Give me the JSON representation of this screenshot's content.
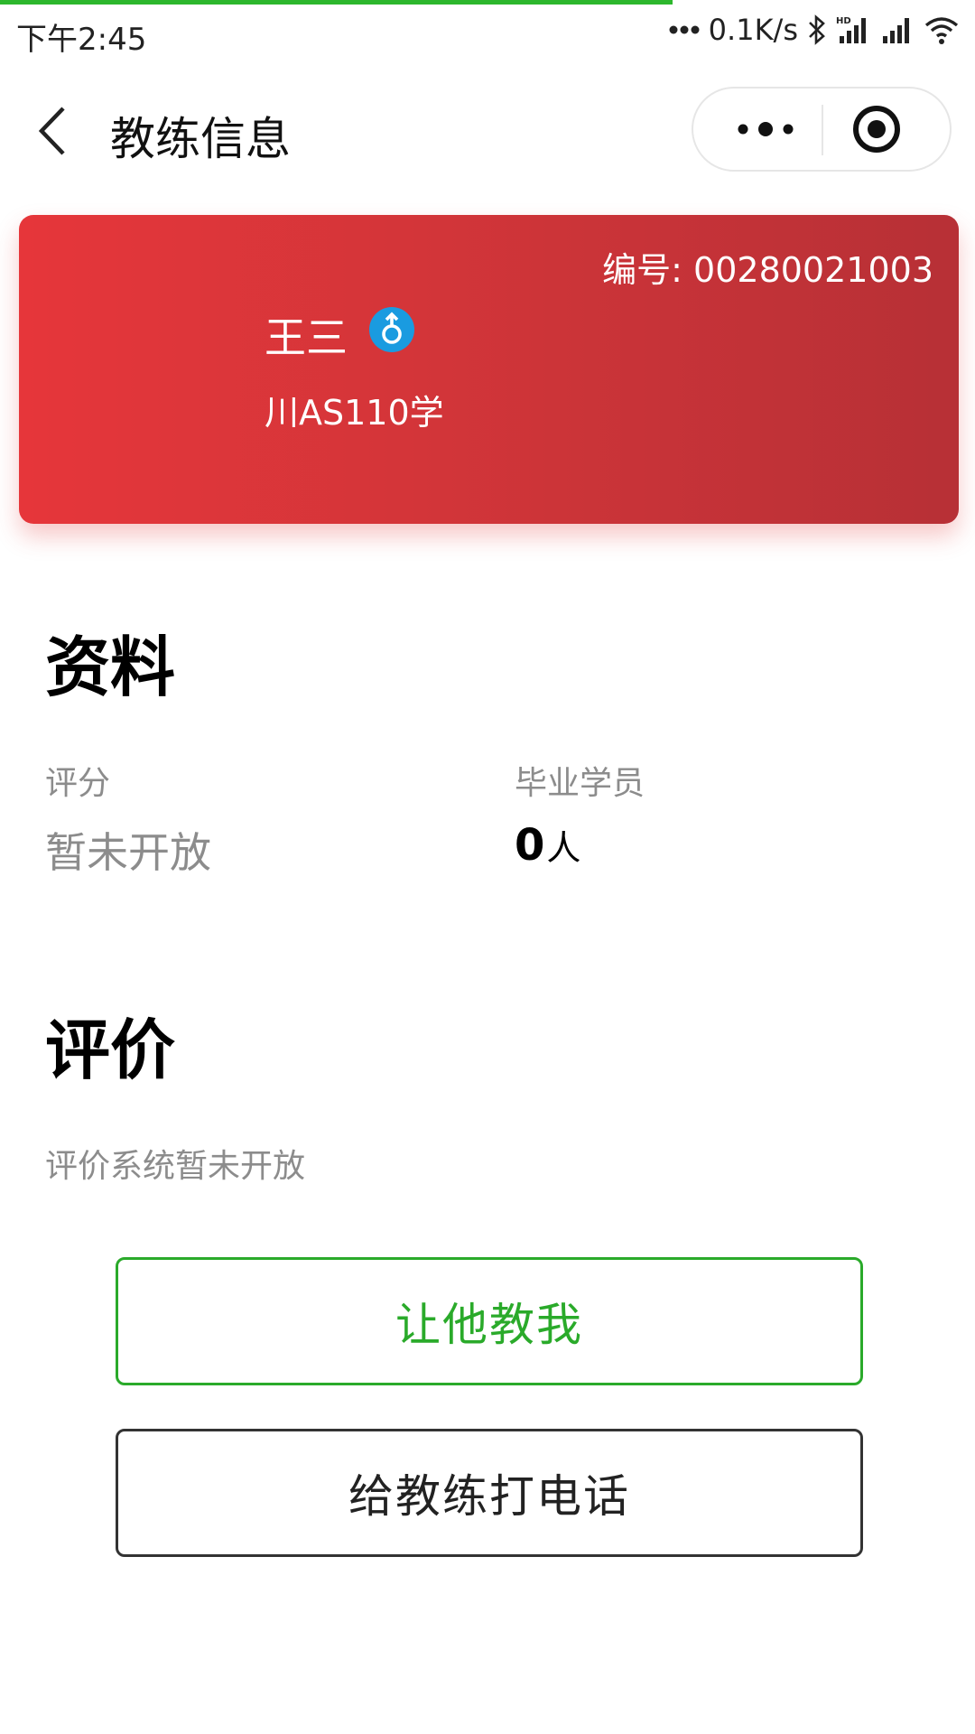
{
  "status_bar": {
    "time": "下午2:45",
    "net_speed": "0.1K/s",
    "hd_label": "HD"
  },
  "loading_progress": 0.69,
  "nav": {
    "title": "教练信息"
  },
  "coach_card": {
    "id_label": "编号",
    "id_value": "00280021003",
    "name": "王三",
    "gender": "male",
    "plate": "川AS110学",
    "colors": {
      "gradient_start": "#e6363a",
      "gradient_end": "#b73036",
      "gender_icon": "#1a9be0"
    }
  },
  "profile": {
    "title": "资料",
    "rating_label": "评分",
    "rating_value": "暂未开放",
    "graduates_label": "毕业学员",
    "graduates_value": "0",
    "graduates_unit": "人"
  },
  "reviews": {
    "title": "评价",
    "empty_text": "评价系统暂未开放"
  },
  "buttons": {
    "teach_me": "让他教我",
    "call_coach": "给教练打电话"
  },
  "colors": {
    "accent_green": "#2aaa2a",
    "loading_bar": "#2db72d"
  }
}
